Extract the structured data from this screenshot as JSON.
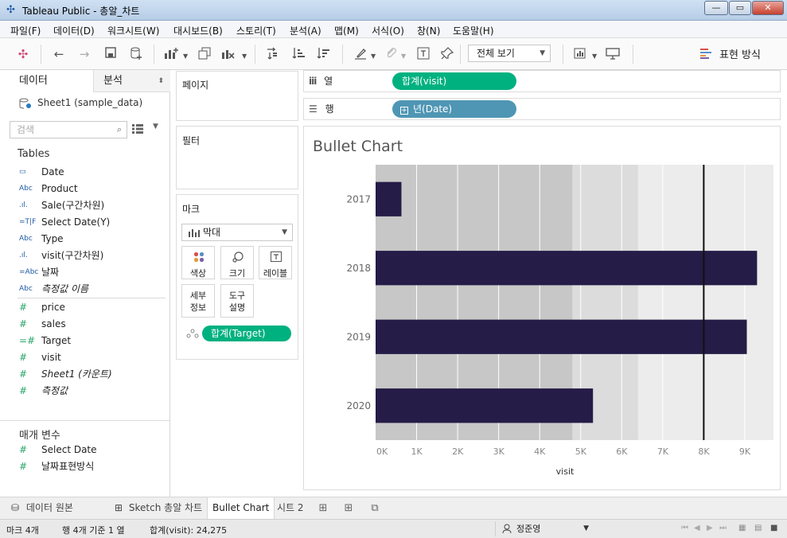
{
  "window": {
    "title": "Tableau Public - 총알_차트",
    "controls": {
      "minimize": "—",
      "maximize": "▭",
      "close": "✕"
    }
  },
  "menu": [
    "파일(F)",
    "데이터(D)",
    "워크시트(W)",
    "대시보드(B)",
    "스토리(T)",
    "분석(A)",
    "맵(M)",
    "서식(O)",
    "창(N)",
    "도움말(H)"
  ],
  "toolbar": {
    "view_select": "전체 보기",
    "show_me_label": "표현 방식",
    "icons": [
      "tableau-logo-icon",
      "undo-icon",
      "redo-icon",
      "save-icon",
      "new-datasource-icon",
      "new-worksheet-icon",
      "duplicate-icon",
      "clear-icon",
      "swap-icon",
      "sort-ascending-icon",
      "sort-descending-icon",
      "highlight-icon",
      "group-icon",
      "label-icon",
      "pin-icon",
      "show-cards-icon",
      "presentation-icon"
    ]
  },
  "data_pane": {
    "tab_data": "데이터",
    "tab_analysis": "분석",
    "datasource": "Sheet1 (sample_data)",
    "search_placeholder": "검색",
    "tables_header": "Tables",
    "dimensions": [
      {
        "icon": "calendar-icon",
        "glyph": "▭",
        "name": "Date",
        "italic": false
      },
      {
        "icon": "abc-icon",
        "glyph": "Abc",
        "name": "Product",
        "italic": false
      },
      {
        "icon": "bin-icon",
        "glyph": ".ıl.",
        "name": "Sale(구간차원)",
        "italic": false
      },
      {
        "icon": "calc-boolean-icon",
        "glyph": "=T|F",
        "name": "Select Date(Y)",
        "italic": false
      },
      {
        "icon": "abc-icon",
        "glyph": "Abc",
        "name": "Type",
        "italic": false
      },
      {
        "icon": "bin-icon",
        "glyph": ".ıl.",
        "name": "visit(구간차원)",
        "italic": false
      },
      {
        "icon": "calc-abc-icon",
        "glyph": "=Abc",
        "name": "날짜",
        "italic": false
      },
      {
        "icon": "abc-icon",
        "glyph": "Abc",
        "name": "측정값 이름",
        "italic": true
      }
    ],
    "measures": [
      {
        "icon": "number-icon",
        "glyph": "#",
        "name": "price",
        "italic": false
      },
      {
        "icon": "number-icon",
        "glyph": "#",
        "name": "sales",
        "italic": false
      },
      {
        "icon": "calc-number-icon",
        "glyph": "=#",
        "name": "Target",
        "italic": false
      },
      {
        "icon": "number-icon",
        "glyph": "#",
        "name": "visit",
        "italic": false
      },
      {
        "icon": "number-icon",
        "glyph": "#",
        "name": "Sheet1 (카운트)",
        "italic": true
      },
      {
        "icon": "number-icon",
        "glyph": "#",
        "name": "측정값",
        "italic": true
      }
    ],
    "params_header": "매개 변수",
    "parameters": [
      {
        "icon": "number-icon",
        "glyph": "#",
        "name": "Select Date"
      },
      {
        "icon": "number-icon",
        "glyph": "#",
        "name": "날짜표현방식"
      }
    ]
  },
  "shelves": {
    "pages": "페이지",
    "filters": "필터",
    "marks": "마크",
    "mark_type": "막대",
    "mark_buttons": {
      "color": "색상",
      "size": "크기",
      "label": "레이블",
      "detail": "세부\n정보",
      "tooltip": "도구\n설명"
    },
    "detail_line1": "세부",
    "detail_line2": "정보",
    "tooltip_line1": "도구",
    "tooltip_line2": "설명",
    "marks_pill": "합계(Target)",
    "columns_label": "열",
    "columns_pill": "합계(visit)",
    "rows_label": "행",
    "rows_pill": "년(Date)"
  },
  "viz": {
    "title": "Bullet Chart"
  },
  "chart_data": {
    "type": "bar",
    "orientation": "horizontal",
    "categories": [
      "2017",
      "2018",
      "2019",
      "2020"
    ],
    "series": [
      {
        "name": "visit",
        "values": [
          630,
          9300,
          9050,
          5300
        ],
        "color": "#251c47"
      }
    ],
    "reference_line": {
      "value": 8000,
      "color": "#111111"
    },
    "reference_bands": [
      {
        "from": 0,
        "to": 4800,
        "color": "#c7c7c7"
      },
      {
        "from": 4800,
        "to": 6400,
        "color": "#dcdcdc"
      },
      {
        "from": 6400,
        "to": 9700,
        "color": "#ececec"
      }
    ],
    "x_ticks": [
      "0K",
      "1K",
      "2K",
      "3K",
      "4K",
      "5K",
      "6K",
      "7K",
      "8K",
      "9K"
    ],
    "xlim": [
      0,
      9700
    ],
    "xlabel": "visit",
    "ylabel": "",
    "grid": true
  },
  "sheet_tabs": {
    "datasource": "데이터 원본",
    "tabs": [
      "Sketch 총알 차트",
      "Bullet Chart",
      "시트 2"
    ],
    "active": 1
  },
  "status": {
    "marks": "마크 4개",
    "rows_cols": "행 4개 기준 1 열",
    "sum": "합계(visit): 24,275",
    "user": "정준영"
  }
}
